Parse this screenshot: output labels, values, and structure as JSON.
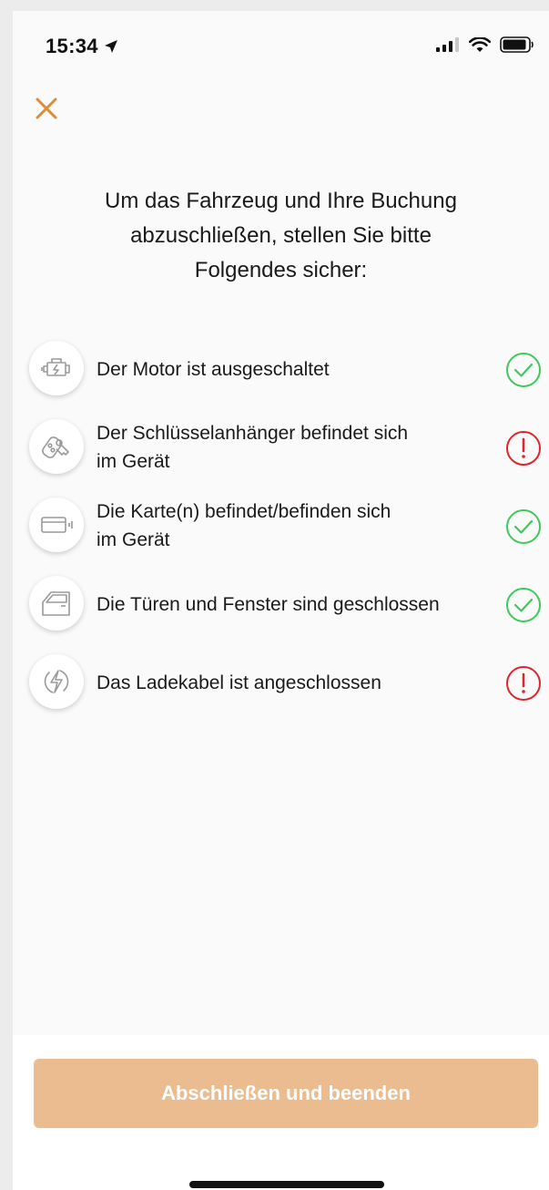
{
  "status_bar": {
    "time": "15:34"
  },
  "heading": "Um das Fahrzeug und Ihre Buchung\nabzuschließen, stellen Sie bitte\nFolgendes sicher:",
  "checklist": [
    {
      "label": "Der Motor ist ausgeschaltet",
      "icon": "engine-icon",
      "status": "ok"
    },
    {
      "label": "Der Schlüsselanhänger befindet sich\nim Gerät",
      "icon": "key-fob-icon",
      "status": "warning"
    },
    {
      "label": "Die Karte(n) befindet/befinden sich\nim Gerät",
      "icon": "card-icon",
      "status": "ok"
    },
    {
      "label": "Die Türen und Fenster sind geschlossen",
      "icon": "car-door-icon",
      "status": "ok"
    },
    {
      "label": "Das Ladekabel ist angeschlossen",
      "icon": "charging-icon",
      "status": "warning"
    }
  ],
  "finish_button": {
    "label": "Abschließen und beenden"
  },
  "colors": {
    "accent": "#e08a3c",
    "ok": "#3ccb5a",
    "warning": "#e0242c",
    "button_bg": "#ebbc90",
    "icon_gray": "#9a9a9a"
  }
}
